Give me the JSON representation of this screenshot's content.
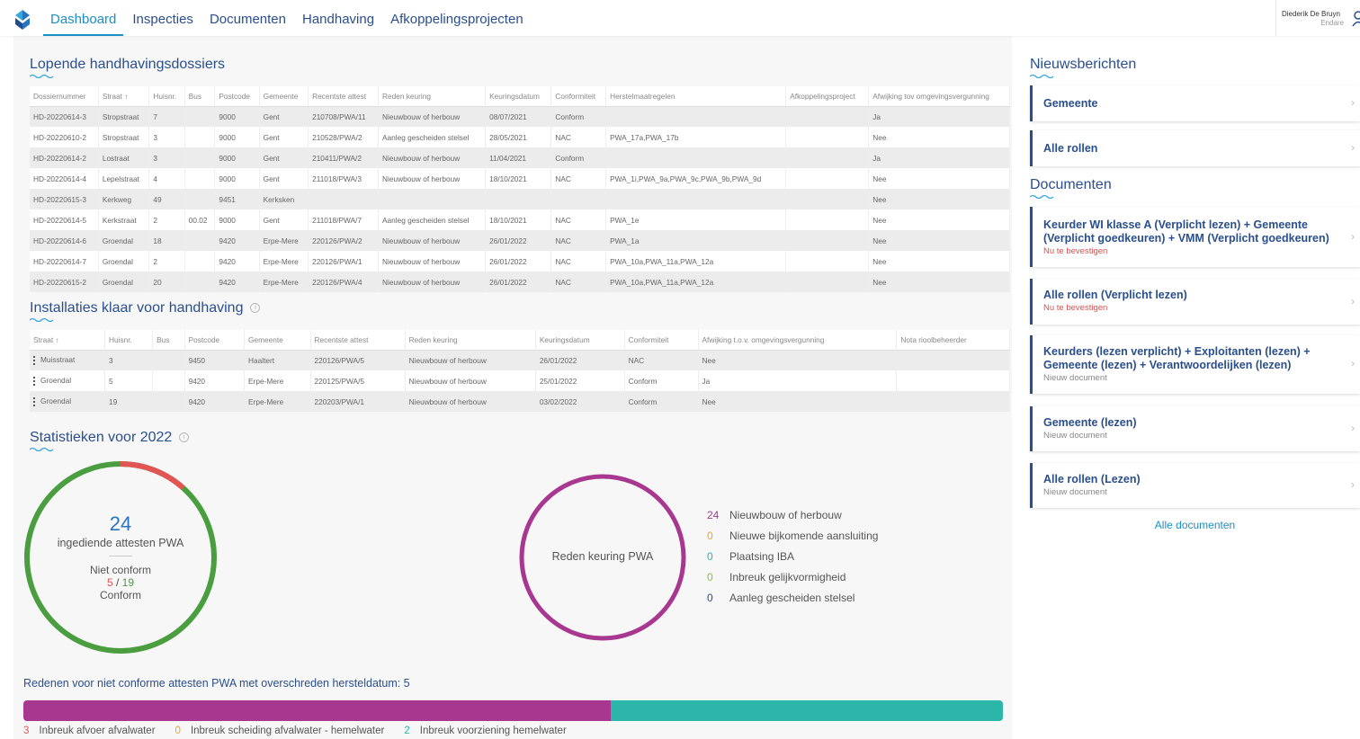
{
  "nav": {
    "items": [
      "Dashboard",
      "Inspecties",
      "Documenten",
      "Handhaving",
      "Afkoppelingsprojecten"
    ]
  },
  "user": {
    "name": "Diederik De Bruyn",
    "org": "Endare"
  },
  "lopende": {
    "title": "Lopende handhavingsdossiers",
    "headers": [
      "Dossiernummer",
      "Straat ↑",
      "Huisnr.",
      "Bus",
      "Postcode",
      "Gemeente",
      "Recentste attest",
      "Reden keuring",
      "Keuringsdatum",
      "Conformiteit",
      "Herstelmaatregelen",
      "Afkoppelingsproject",
      "Afwijking tov omgevingsvergunning"
    ],
    "rows": [
      [
        "HD-20220614-3",
        "Stropstraat",
        "7",
        "",
        "9000",
        "Gent",
        "210708/PWA/11",
        "Nieuwbouw of herbouw",
        "08/07/2021",
        "Conform",
        "",
        "",
        "Ja"
      ],
      [
        "HD-20220610-2",
        "Stropstraat",
        "3",
        "",
        "9000",
        "Gent",
        "210528/PWA/2",
        "Aanleg gescheiden stelsel",
        "28/05/2021",
        "NAC",
        "PWA_17a,PWA_17b",
        "",
        "Nee"
      ],
      [
        "HD-20220614-2",
        "Lostraat",
        "3",
        "",
        "9000",
        "Gent",
        "210411/PWA/2",
        "Nieuwbouw of herbouw",
        "11/04/2021",
        "Conform",
        "",
        "",
        "Ja"
      ],
      [
        "HD-20220614-4",
        "Lepelstraat",
        "4",
        "",
        "9000",
        "Gent",
        "211018/PWA/3",
        "Nieuwbouw of herbouw",
        "18/10/2021",
        "NAC",
        "PWA_1i,PWA_9a,PWA_9c,PWA_9b,PWA_9d",
        "",
        "Nee"
      ],
      [
        "HD-20220615-3",
        "Kerkweg",
        "49",
        "",
        "9451",
        "Kerksken",
        "",
        "",
        "",
        "",
        "",
        "",
        "Nee"
      ],
      [
        "HD-20220614-5",
        "Kerkstraat",
        "2",
        "00.02",
        "9000",
        "Gent",
        "211018/PWA/7",
        "Aanleg gescheiden stelsel",
        "18/10/2021",
        "NAC",
        "PWA_1e",
        "",
        "Nee"
      ],
      [
        "HD-20220614-6",
        "Groendal",
        "18",
        "",
        "9420",
        "Erpe-Mere",
        "220126/PWA/2",
        "Nieuwbouw of herbouw",
        "26/01/2022",
        "NAC",
        "PWA_1a",
        "",
        "Nee"
      ],
      [
        "HD-20220614-7",
        "Groendal",
        "2",
        "",
        "9420",
        "Erpe-Mere",
        "220126/PWA/1",
        "Nieuwbouw of herbouw",
        "26/01/2022",
        "NAC",
        "PWA_10a,PWA_11a,PWA_12a",
        "",
        "Nee"
      ],
      [
        "HD-20220615-2",
        "Groendal",
        "20",
        "",
        "9420",
        "Erpe-Mere",
        "220126/PWA/4",
        "Nieuwbouw of herbouw",
        "26/01/2022",
        "NAC",
        "PWA_10a,PWA_11a,PWA_12a",
        "",
        "Nee"
      ]
    ]
  },
  "installaties": {
    "title": "Installaties klaar voor handhaving",
    "info": "i",
    "headers": [
      "Straat ↑",
      "Huisnr.",
      "Bus",
      "Postcode",
      "Gemeente",
      "Recentste attest",
      "Reden keuring",
      "Keuringsdatum",
      "Conformiteit",
      "Afwijking t.o.v. omgevingsvergunning",
      "Nota rioolbeheerder"
    ],
    "rows": [
      [
        "Muisstraat",
        "3",
        "",
        "9450",
        "Haaltert",
        "220126/PWA/5",
        "Nieuwbouw of herbouw",
        "26/01/2022",
        "NAC",
        "Nee",
        ""
      ],
      [
        "Groendal",
        "5",
        "",
        "9420",
        "Erpe-Mere",
        "220125/PWA/5",
        "Nieuwbouw of herbouw",
        "25/01/2022",
        "Conform",
        "Ja",
        ""
      ],
      [
        "Groendal",
        "19",
        "",
        "9420",
        "Erpe-Mere",
        "220203/PWA/1",
        "Nieuwbouw of herbouw",
        "03/02/2022",
        "Conform",
        "Nee",
        ""
      ]
    ]
  },
  "stats": {
    "title": "Statistieken voor 2022",
    "info": "i",
    "donut1": {
      "count": "24",
      "label": "ingediende attesten PWA",
      "niet_conform_label": "Niet conform",
      "niet_conform": "5",
      "sep": "/",
      "conform": "19",
      "conform_label": "Conform",
      "red": "#e15554",
      "green": "#4a9e3f"
    },
    "donut2": {
      "label": "Reden keuring PWA",
      "color": "#a8378f"
    },
    "legend": [
      {
        "n": "24",
        "label": "Nieuwbouw of herbouw",
        "color": "#a8378f"
      },
      {
        "n": "0",
        "label": "Nieuwe bijkomende aansluiting",
        "color": "#e8a33d"
      },
      {
        "n": "0",
        "label": "Plaatsing IBA",
        "color": "#2cb5a9"
      },
      {
        "n": "0",
        "label": "Inbreuk gelijkvormigheid",
        "color": "#8bbf3f"
      },
      {
        "n": "0",
        "label": "Aanleg gescheiden stelsel",
        "color": "#2a4f8d"
      }
    ],
    "redenen": {
      "title": "Redenen voor niet conforme attesten PWA met overschreden hersteldatum: 5",
      "bar": [
        {
          "value": 3,
          "color": "#a8378f"
        },
        {
          "value": 0,
          "color": "#e8a33d"
        },
        {
          "value": 2,
          "color": "#2cb5a9"
        }
      ],
      "legend": [
        {
          "n": "3",
          "label": "Inbreuk afvoer afvalwater",
          "color": "#e15554"
        },
        {
          "n": "0",
          "label": "Inbreuk scheiding afvalwater - hemelwater",
          "color": "#e8a33d"
        },
        {
          "n": "2",
          "label": "Inbreuk voorziening hemelwater",
          "color": "#2cb5a9"
        }
      ]
    }
  },
  "nieuws": {
    "title": "Nieuwsberichten",
    "items": [
      "Gemeente",
      "Alle rollen"
    ]
  },
  "documenten": {
    "title": "Documenten",
    "items": [
      {
        "t": "Keurder WI klasse A (Verplicht lezen) + Gemeente (Verplicht goedkeuren) + VMM (Verplicht goedkeuren)",
        "s": "Nu te bevestigen"
      },
      {
        "t": "Alle rollen (Verplicht lezen)",
        "s": "Nu te bevestigen"
      },
      {
        "t": "Keurders (lezen verplicht) + Exploitanten (lezen) + Gemeente (lezen) + Verantwoordelijken (lezen)",
        "s": "Nieuw document"
      },
      {
        "t": "Gemeente (lezen)",
        "s": "Nieuw document"
      },
      {
        "t": "Alle rollen (Lezen)",
        "s": "Nieuw document"
      }
    ],
    "all_link": "Alle documenten"
  },
  "chevron": "›"
}
